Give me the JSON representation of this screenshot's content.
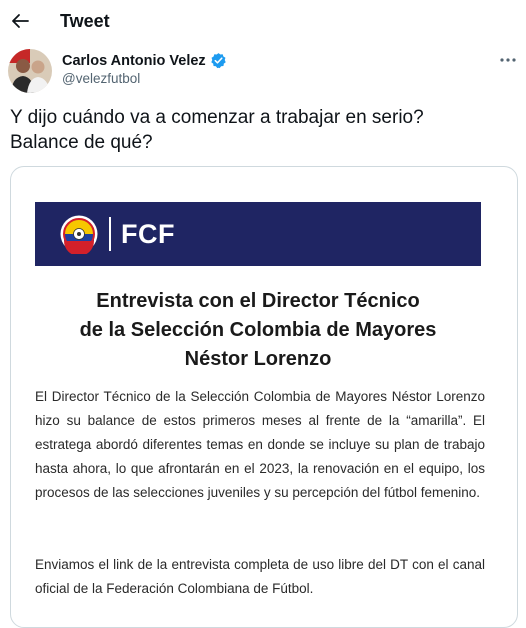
{
  "header": {
    "back_icon": "arrow-left-icon",
    "title": "Tweet"
  },
  "author": {
    "name": "Carlos Antonio Velez",
    "handle": "@velezfutbol",
    "verified_icon": "verified-badge-icon",
    "more_icon": "more-dots-icon"
  },
  "tweet": {
    "text_line1": "Y dijo cuándo va a comenzar a trabajar en serio?",
    "text_line2": "Balance de qué?"
  },
  "document": {
    "header_brand": "FCF",
    "title_line1": "Entrevista con el Director Técnico",
    "title_line2": "de la Selección Colombia de Mayores",
    "title_line3": "Néstor Lorenzo",
    "paragraph1": "El Director Técnico de la Selección Colombia de Mayores Néstor Lorenzo hizo su balance de estos primeros meses al frente de la “amarilla”. El estratega abordó diferentes temas en donde se incluye su plan de trabajo hasta ahora, lo que afrontarán en el 2023, la renovación en el equipo, los procesos de las selecciones juveniles y su percepción del fútbol femenino.",
    "paragraph2": "Enviamos el link de la entrevista completa de uso libre del DT con el canal oficial de la Federación Colombiana de Fútbol."
  },
  "colors": {
    "verified": "#1d9bf0",
    "fcf_header_bg": "#1f2563",
    "handle_text": "#536471",
    "card_border": "#cfd9de"
  }
}
